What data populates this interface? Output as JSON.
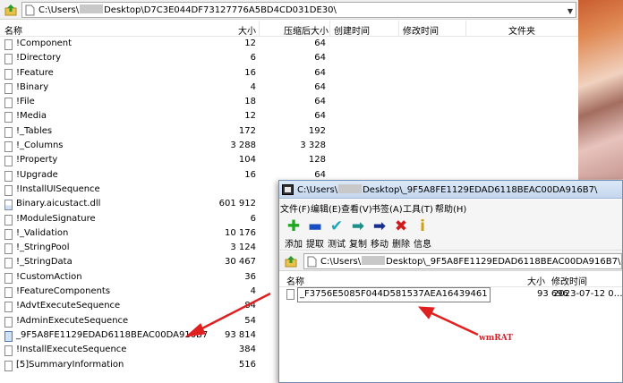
{
  "back_window": {
    "address": {
      "path_prefix": "C:\\Users\\",
      "path_suffix": "Desktop\\D7C3E044DF73127776A5BD4CD031DE30\\"
    },
    "columns": {
      "name": "名称",
      "size": "大小",
      "compressed": "压缩后大小",
      "created": "创建时间",
      "modified": "修改时间",
      "folder": "文件夹"
    },
    "rows": [
      {
        "name": "!Component",
        "size": "12",
        "compressed": "64",
        "icon": "file"
      },
      {
        "name": "!Directory",
        "size": "6",
        "compressed": "64",
        "icon": "file"
      },
      {
        "name": "!Feature",
        "size": "16",
        "compressed": "64",
        "icon": "file"
      },
      {
        "name": "!Binary",
        "size": "4",
        "compressed": "64",
        "icon": "file"
      },
      {
        "name": "!File",
        "size": "18",
        "compressed": "64",
        "icon": "file"
      },
      {
        "name": "!Media",
        "size": "12",
        "compressed": "64",
        "icon": "file"
      },
      {
        "name": "!_Tables",
        "size": "172",
        "compressed": "192",
        "icon": "file"
      },
      {
        "name": "!_Columns",
        "size": "3 288",
        "compressed": "3 328",
        "icon": "file"
      },
      {
        "name": "!Property",
        "size": "104",
        "compressed": "128",
        "icon": "file"
      },
      {
        "name": "!Upgrade",
        "size": "16",
        "compressed": "64",
        "icon": "file"
      },
      {
        "name": "!InstallUISequence",
        "size": "",
        "compressed": "",
        "icon": "file"
      },
      {
        "name": "Binary.aicustact.dll",
        "size": "601 912",
        "compressed": "",
        "icon": "dll"
      },
      {
        "name": "!ModuleSignature",
        "size": "6",
        "compressed": "",
        "icon": "file"
      },
      {
        "name": "!_Validation",
        "size": "10 176",
        "compressed": "",
        "icon": "file"
      },
      {
        "name": "!_StringPool",
        "size": "3 124",
        "compressed": "",
        "icon": "file"
      },
      {
        "name": "!_StringData",
        "size": "30 467",
        "compressed": "",
        "icon": "file"
      },
      {
        "name": "!CustomAction",
        "size": "36",
        "compressed": "",
        "icon": "file"
      },
      {
        "name": "!FeatureComponents",
        "size": "4",
        "compressed": "",
        "icon": "file"
      },
      {
        "name": "!AdvtExecuteSequence",
        "size": "84",
        "compressed": "",
        "icon": "file"
      },
      {
        "name": "!AdminExecuteSequence",
        "size": "54",
        "compressed": "",
        "icon": "file"
      },
      {
        "name": "_9F5A8FE1129EDAD6118BEAC00DA916B7",
        "size": "93 814",
        "compressed": "",
        "icon": "sel"
      },
      {
        "name": "!InstallExecuteSequence",
        "size": "384",
        "compressed": "",
        "icon": "file"
      },
      {
        "name": "[5]SummaryInformation",
        "size": "516",
        "compressed": "",
        "icon": "file"
      }
    ]
  },
  "front_window": {
    "title_prefix": "C:\\Users\\",
    "title_suffix": "Desktop\\_9F5A8FE1129EDAD6118BEAC00DA916B7\\",
    "menu": [
      "文件(F)",
      "编辑(E)",
      "查看(V)",
      "书签(A)",
      "工具(T)",
      "帮助(H)"
    ],
    "toolbar": [
      {
        "label": "添加",
        "icon": "add-icon",
        "glyph": "✚",
        "color": "#1fa81f"
      },
      {
        "label": "提取",
        "icon": "extract-icon",
        "glyph": "▬",
        "color": "#1a4fc4"
      },
      {
        "label": "测试",
        "icon": "test-icon",
        "glyph": "✔",
        "color": "#1fa6b8"
      },
      {
        "label": "复制",
        "icon": "copy-icon",
        "glyph": "➡",
        "color": "#1c8f8a"
      },
      {
        "label": "移动",
        "icon": "move-icon",
        "glyph": "➡",
        "color": "#1a2f8c"
      },
      {
        "label": "删除",
        "icon": "delete-icon",
        "glyph": "✖",
        "color": "#d11a1a"
      },
      {
        "label": "信息",
        "icon": "info-icon",
        "glyph": "i",
        "color": "#d1a010"
      }
    ],
    "address": {
      "path_prefix": "C:\\Users\\",
      "path_suffix": "Desktop\\_9F5A8FE1129EDAD6118BEAC00DA916B7\\"
    },
    "columns": {
      "name": "名称",
      "size": "大小",
      "modified": "修改时间"
    },
    "file": {
      "name": "_F3756E5085F044D581537AEA16439461",
      "size": "93 696",
      "modified": "2023-07-12 0…"
    }
  },
  "annotation": {
    "label": "wmRAT",
    "color": "#d2222a"
  }
}
